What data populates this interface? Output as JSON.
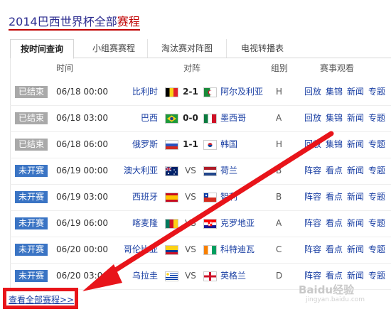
{
  "title": {
    "prefix": "2014巴西世界杯全部",
    "highlight": "赛程"
  },
  "tabs": [
    {
      "label": "按时间查询",
      "active": true
    },
    {
      "label": "小组赛赛程",
      "active": false
    },
    {
      "label": "淘汰赛对阵图",
      "active": false
    },
    {
      "label": "电视转播表",
      "active": false
    }
  ],
  "columns": {
    "time": "时间",
    "match": "对阵",
    "group": "组别",
    "watch": "赛事观看"
  },
  "status_colors": {
    "finished": "#a9a9a9",
    "upcoming": "#3a74c4"
  },
  "matches": [
    {
      "status": "已结束",
      "time": "06/18 00:00",
      "home": "比利时",
      "score": "2-1",
      "away": "阿尔及利亚",
      "group": "H",
      "links": [
        "回放",
        "集锦",
        "新闻",
        "专题"
      ]
    },
    {
      "status": "已结束",
      "time": "06/18 03:00",
      "home": "巴西",
      "score": "0-0",
      "away": "墨西哥",
      "group": "A",
      "links": [
        "回放",
        "集锦",
        "新闻",
        "专题"
      ]
    },
    {
      "status": "已结束",
      "time": "06/18 06:00",
      "home": "俄罗斯",
      "score": "1-1",
      "away": "韩国",
      "group": "H",
      "links": [
        "回放",
        "集锦",
        "新闻",
        "专题"
      ]
    },
    {
      "status": "未开赛",
      "time": "06/19 00:00",
      "home": "澳大利亚",
      "score": "VS",
      "away": "荷兰",
      "group": "B",
      "links": [
        "阵容",
        "看点",
        "新闻",
        "专题"
      ]
    },
    {
      "status": "未开赛",
      "time": "06/19 03:00",
      "home": "西班牙",
      "score": "VS",
      "away": "智利",
      "group": "B",
      "links": [
        "阵容",
        "看点",
        "新闻",
        "专题"
      ]
    },
    {
      "status": "未开赛",
      "time": "06/19 06:00",
      "home": "喀麦隆",
      "score": "VS",
      "away": "克罗地亚",
      "group": "A",
      "links": [
        "阵容",
        "看点",
        "新闻",
        "专题"
      ]
    },
    {
      "status": "未开赛",
      "time": "06/20 00:00",
      "home": "哥伦比亚",
      "score": "VS",
      "away": "科特迪瓦",
      "group": "C",
      "links": [
        "阵容",
        "看点",
        "新闻",
        "专题"
      ]
    },
    {
      "status": "未开赛",
      "time": "06/20 03:00",
      "home": "乌拉圭",
      "score": "VS",
      "away": "英格兰",
      "group": "D",
      "links": [
        "阵容",
        "看点",
        "新闻",
        "专题"
      ]
    }
  ],
  "view_all": "查看全部赛程>>",
  "annotation": {
    "arrow_color": "#e8141a"
  },
  "watermark": {
    "logo": "Baidu经验",
    "url": "jingyan.baidu.com"
  }
}
